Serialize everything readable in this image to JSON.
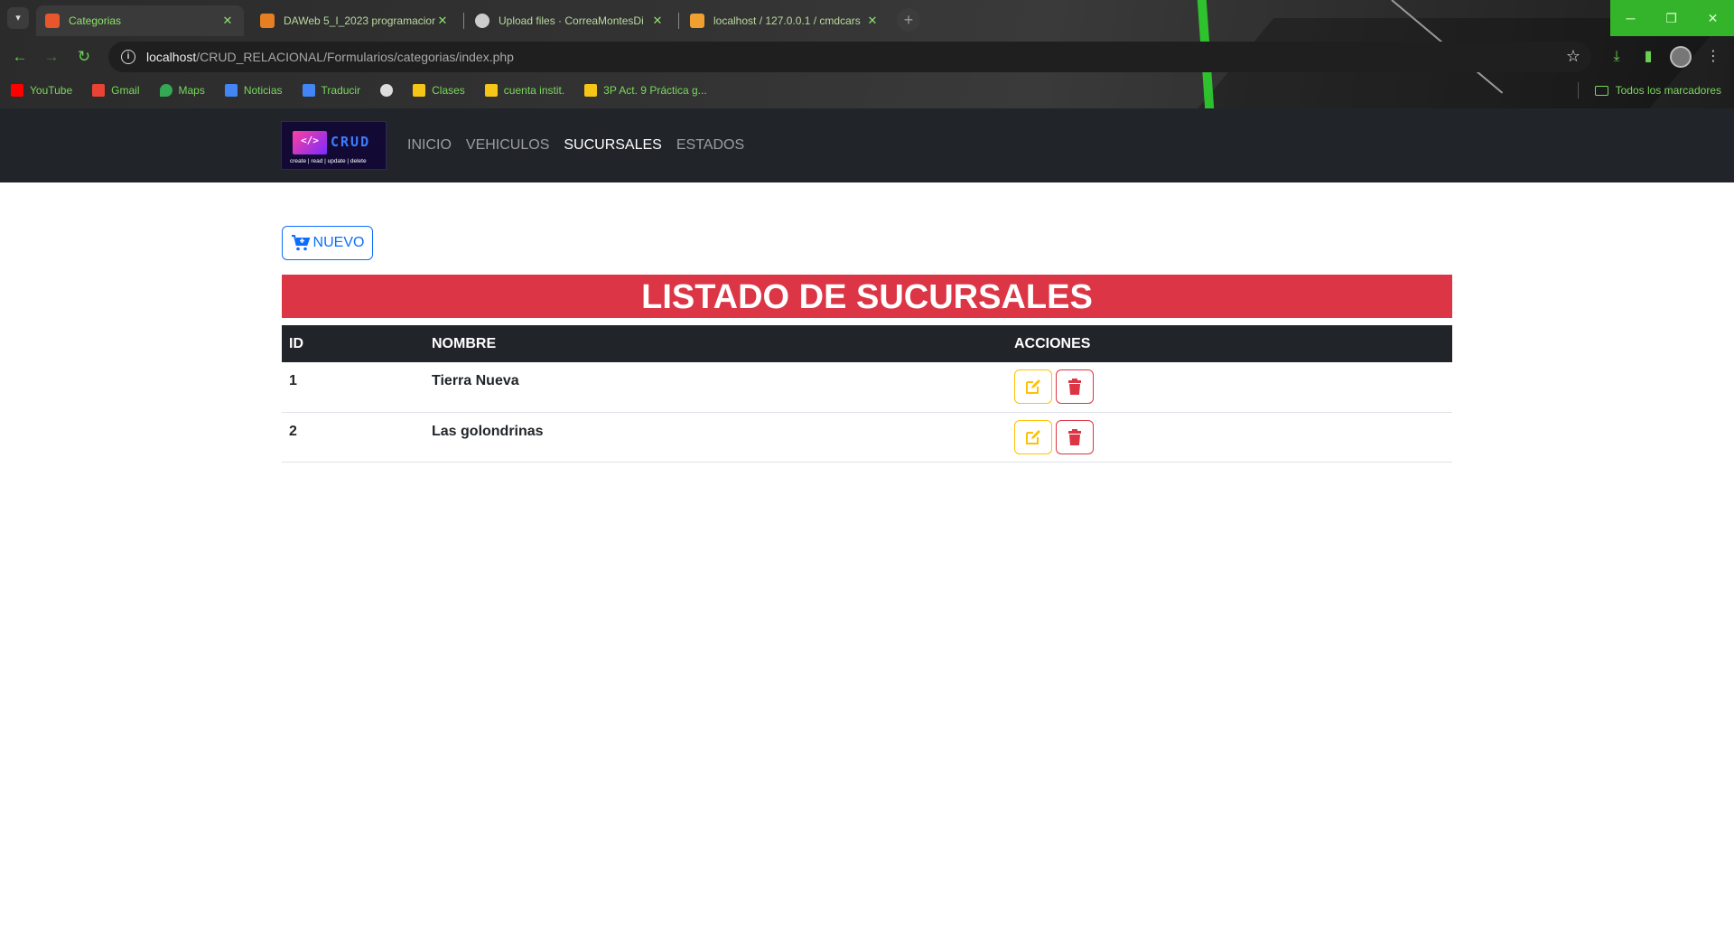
{
  "browser": {
    "tabs": [
      {
        "title": "Categorias",
        "active": true,
        "favicon_color": "#e8572b"
      },
      {
        "title": "DAWeb 5_I_2023 programacion",
        "active": false,
        "favicon_color": "#e67e22"
      },
      {
        "title": "Upload files · CorreaMontesDi",
        "active": false,
        "favicon_color": "#cccccc"
      },
      {
        "title": "localhost / 127.0.0.1 / cmdcars",
        "active": false,
        "favicon_color": "#f0a030"
      }
    ],
    "url_host": "localhost",
    "url_path": "/CRUD_RELACIONAL/Formularios/categorias/index.php",
    "bookmarks": [
      {
        "label": "YouTube",
        "icon": "youtube-icon",
        "color": "#ff0000"
      },
      {
        "label": "Gmail",
        "icon": "gmail-icon",
        "color": "#ea4335"
      },
      {
        "label": "Maps",
        "icon": "maps-icon",
        "color": "#34a853"
      },
      {
        "label": "Noticias",
        "icon": "news-icon",
        "color": "#4285f4"
      },
      {
        "label": "Traducir",
        "icon": "translate-icon",
        "color": "#4285f4"
      },
      {
        "label": "",
        "icon": "globe-icon",
        "color": "#dddddd"
      },
      {
        "label": "Clases",
        "icon": "classroom-icon",
        "color": "#f5c518"
      },
      {
        "label": "cuenta instit.",
        "icon": "classroom-icon",
        "color": "#f5c518"
      },
      {
        "label": "3P Act. 9 Práctica g...",
        "icon": "classroom-icon",
        "color": "#f5c518"
      }
    ],
    "all_bookmarks": "Todos los marcadores",
    "accent_color": "#34b42a"
  },
  "site": {
    "logo": {
      "word": "CRUD",
      "tagline": "create | read | update | delete",
      "code": "</>"
    },
    "nav": [
      {
        "label": "INICIO",
        "active": false
      },
      {
        "label": "VEHICULOS",
        "active": false
      },
      {
        "label": "SUCURSALES",
        "active": true
      },
      {
        "label": "ESTADOS",
        "active": false
      }
    ],
    "new_button": "NUEVO",
    "title": "LISTADO DE SUCURSALES",
    "table": {
      "headers": [
        "ID",
        "NOMBRE",
        "ACCIONES"
      ],
      "rows": [
        {
          "id": "1",
          "nombre": "Tierra Nueva"
        },
        {
          "id": "2",
          "nombre": "Las golondrinas"
        }
      ]
    },
    "colors": {
      "primary": "#0d6efd",
      "danger": "#dc3545",
      "warning": "#ffc107",
      "dark": "#212529"
    }
  }
}
